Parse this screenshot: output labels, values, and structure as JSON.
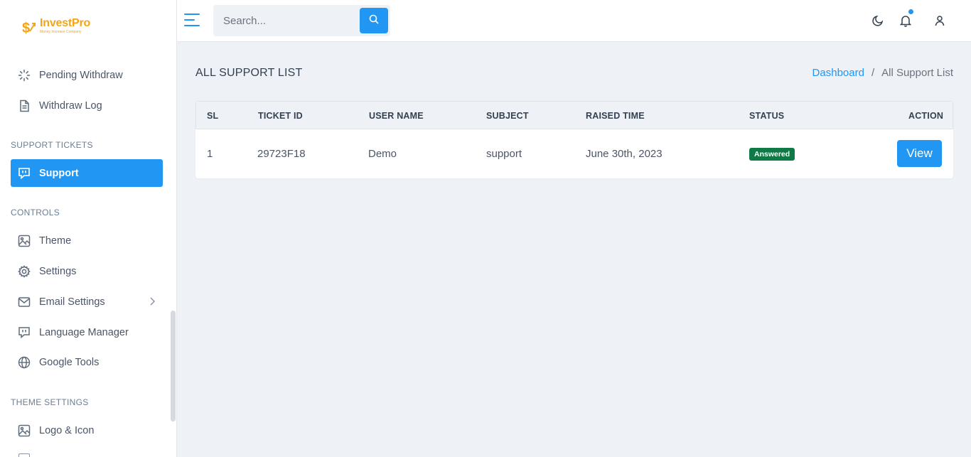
{
  "brand": {
    "name": "InvestPro",
    "tagline": "Money Increase Company",
    "color": "#f5a417"
  },
  "sidebar": {
    "items_top": [
      {
        "label": "Pending Withdraw",
        "icon": "loader-icon"
      },
      {
        "label": "Withdraw Log",
        "icon": "document-icon"
      }
    ],
    "section_support": "SUPPORT TICKETS",
    "support_item": {
      "label": "Support",
      "icon": "chat-icon",
      "active": true
    },
    "section_controls": "CONTROLS",
    "controls": [
      {
        "label": "Theme",
        "icon": "image-icon"
      },
      {
        "label": "Settings",
        "icon": "gear-icon"
      },
      {
        "label": "Email Settings",
        "icon": "mail-icon"
      },
      {
        "label": "Language Manager",
        "icon": "chat-icon"
      },
      {
        "label": "Google Tools",
        "icon": "globe-icon"
      }
    ],
    "section_theme": "THEME SETTINGS",
    "theme_items": [
      {
        "label": "Logo & Icon",
        "icon": "image-icon"
      }
    ]
  },
  "topbar": {
    "search_placeholder": "Search...",
    "icons": [
      "menu-icon",
      "search-icon",
      "moon-icon",
      "bell-icon",
      "user-icon"
    ]
  },
  "page": {
    "title": "ALL SUPPORT LIST",
    "breadcrumb": {
      "home": "Dashboard",
      "separator": "/",
      "current": "All Support List"
    }
  },
  "table": {
    "headers": {
      "sl": "SL",
      "ticket_id": "TICKET ID",
      "user_name": "USER NAME",
      "subject": "SUBJECT",
      "raised_time": "RAISED TIME",
      "status": "STATUS",
      "action": "ACTION"
    },
    "rows": [
      {
        "sl": "1",
        "ticket_id": "29723F18",
        "user_name": "Demo",
        "subject": "support",
        "raised_time": "June 30th, 2023",
        "status": "Answered",
        "action": "View"
      }
    ]
  },
  "colors": {
    "accent": "#2196f3",
    "success": "#0f7a45",
    "background": "#eef1f5"
  }
}
